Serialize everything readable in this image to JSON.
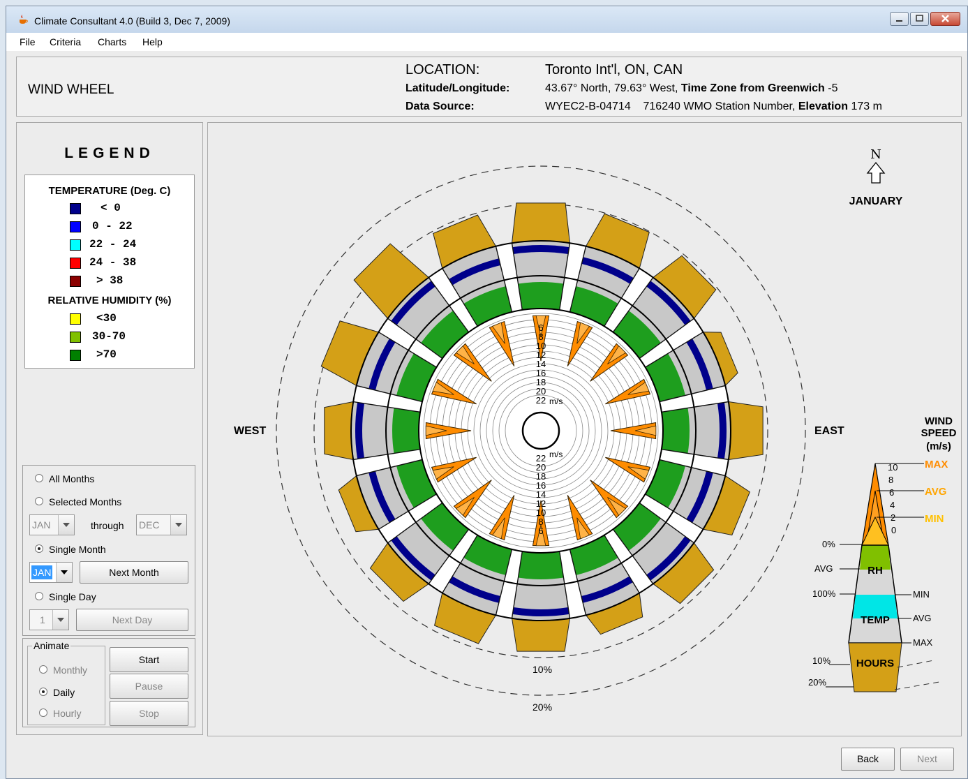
{
  "window": {
    "title": "Climate Consultant 4.0 (Build 3, Dec 7, 2009)"
  },
  "menu": [
    "File",
    "Criteria",
    "Charts",
    "Help"
  ],
  "header": {
    "chart_title": "WIND WHEEL",
    "location_label": "LOCATION:",
    "location_value": "Toronto Int'l, ON, CAN",
    "latlon_label": "Latitude/Longitude:",
    "latlon_value": "43.67° North, 79.63° West,",
    "tz_label": "Time Zone from Greenwich",
    "tz_value": "-5",
    "source_label": "Data Source:",
    "source_value": "WYEC2-B-04714",
    "wmo_value": "716240 WMO Station Number,",
    "elev_label": "Elevation",
    "elev_value": "173 m"
  },
  "legend": {
    "heading": "LEGEND",
    "temp_heading": "TEMPERATURE (Deg. C)",
    "temp_items": [
      {
        "label": "< 0",
        "color": "#00008b"
      },
      {
        "label": "0  -  22",
        "color": "#0000ff"
      },
      {
        "label": "22  -  24",
        "color": "#00ffff"
      },
      {
        "label": "24  -  38",
        "color": "#ff0000"
      },
      {
        "label": "> 38",
        "color": "#8b0000"
      }
    ],
    "rh_heading": "RELATIVE HUMIDITY (%)",
    "rh_items": [
      {
        "label": "<30",
        "color": "#ffff00"
      },
      {
        "label": "30-70",
        "color": "#80c000"
      },
      {
        "label": ">70",
        "color": "#008000"
      }
    ]
  },
  "controls": {
    "all_months": "All Months",
    "selected_months": "Selected Months",
    "from_month": "JAN",
    "through": "through",
    "to_month": "DEC",
    "single_month": "Single Month",
    "month_value": "JAN",
    "next_month": "Next Month",
    "single_day": "Single Day",
    "day_value": "1",
    "next_day": "Next Day"
  },
  "animate": {
    "legend": "Animate",
    "monthly": "Monthly",
    "daily": "Daily",
    "hourly": "Hourly",
    "start": "Start",
    "pause": "Pause",
    "stop": "Stop"
  },
  "chart": {
    "north": "N",
    "month": "JANUARY",
    "west": "WEST",
    "east": "EAST",
    "pct_inner": "10%",
    "pct_outer": "20%",
    "speed_unit": "m/s",
    "speed_rings": [
      "6",
      "8",
      "10",
      "12",
      "14",
      "16",
      "18",
      "20",
      "22"
    ],
    "key": {
      "title1": "WIND",
      "title2": "SPEED",
      "title3": "(m/s)",
      "max": "MAX",
      "avg": "AVG",
      "min": "MIN",
      "ticks": [
        "10",
        "8",
        "6",
        "4",
        "2",
        "0"
      ],
      "rh0": "0%",
      "rh_avg": "AVG",
      "rh100": "100%",
      "rh": "RH",
      "t_min": "MIN",
      "t_avg": "AVG",
      "t_max": "MAX",
      "temp": "TEMP",
      "hours": "HOURS",
      "h10": "10%",
      "h20": "20%"
    },
    "colors": {
      "hours": "#d4a017",
      "speed": "#ff8c00",
      "rh": "#1e9e1e",
      "temp_band": "#00008b",
      "grey": "#c8c8c8"
    }
  },
  "nav": {
    "back": "Back",
    "next": "Next"
  }
}
